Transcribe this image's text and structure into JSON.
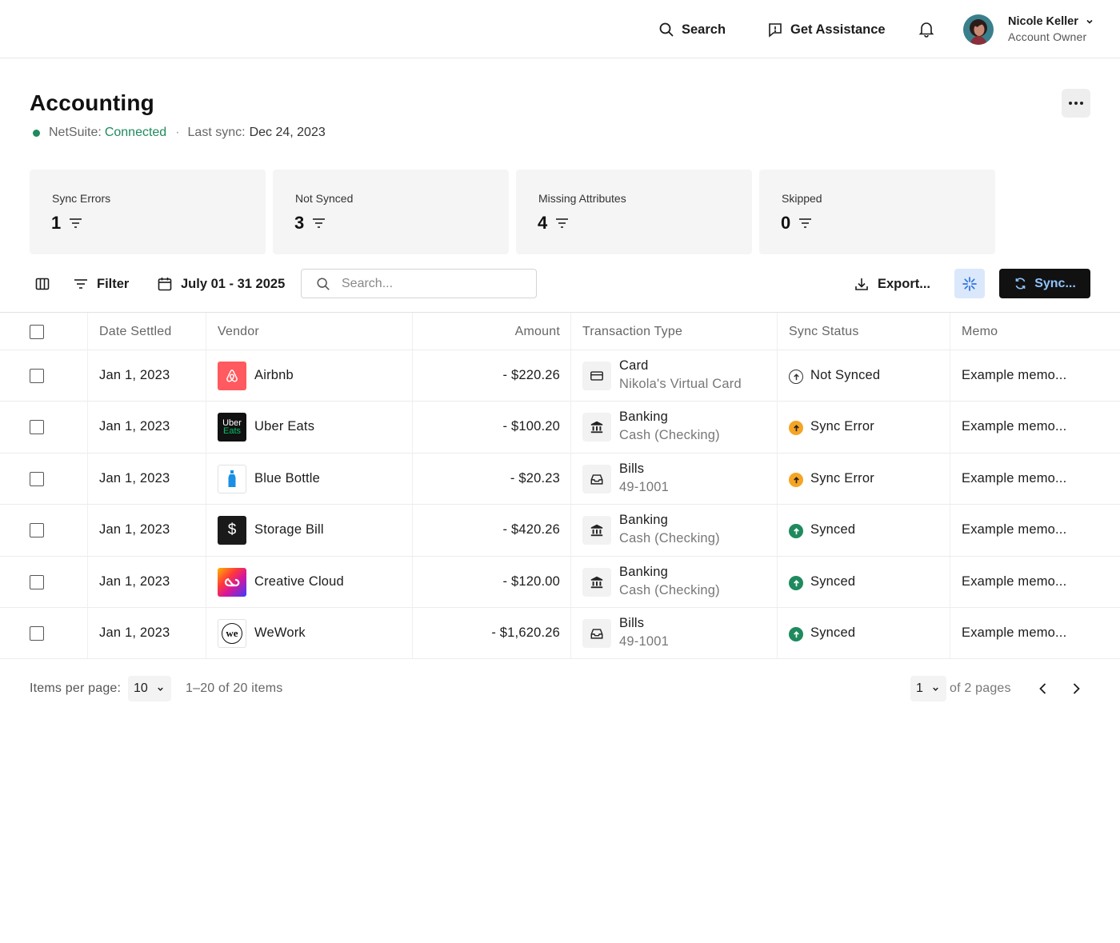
{
  "topbar": {
    "search_label": "Search",
    "assist_label": "Get Assistance",
    "user": {
      "name": "Nicole Keller",
      "role": "Account Owner"
    }
  },
  "header": {
    "title": "Accounting",
    "integration_name": "NetSuite:",
    "integration_status": "Connected",
    "last_sync_label": "Last sync:",
    "last_sync_date": "Dec 24, 2023"
  },
  "stats": [
    {
      "label": "Sync Errors",
      "value": "1"
    },
    {
      "label": "Not Synced",
      "value": "3"
    },
    {
      "label": "Missing Attributes",
      "value": "4"
    },
    {
      "label": "Skipped",
      "value": "0"
    }
  ],
  "toolbar": {
    "filter_label": "Filter",
    "date_range": "July 01 - 31 2025",
    "search_placeholder": "Search...",
    "export_label": "Export...",
    "sync_label": "Sync..."
  },
  "table": {
    "columns": [
      "Date Settled",
      "Vendor",
      "Amount",
      "Transaction Type",
      "Sync Status",
      "Memo"
    ],
    "rows": [
      {
        "date": "Jan 1, 2023",
        "vendor": "Airbnb",
        "logo": "airbnb-logo",
        "amount": "- $220.26",
        "type": "Card",
        "type_sub": "Nikola's Virtual Card",
        "type_icon": "card-icon",
        "status": "Not Synced",
        "status_icon": "not-synced-icon",
        "memo": "Example memo..."
      },
      {
        "date": "Jan 1, 2023",
        "vendor": "Uber Eats",
        "logo": "uber-eats-logo",
        "amount": "- $100.20",
        "type": "Banking",
        "type_sub": "Cash (Checking)",
        "type_icon": "bank-icon",
        "status": "Sync Error",
        "status_icon": "sync-error-icon",
        "memo": "Example memo..."
      },
      {
        "date": "Jan 1, 2023",
        "vendor": "Blue Bottle",
        "logo": "blue-bottle-logo",
        "amount": "- $20.23",
        "type": "Bills",
        "type_sub": "49-1001",
        "type_icon": "inbox-icon",
        "status": "Sync Error",
        "status_icon": "sync-error-icon",
        "memo": "Example memo..."
      },
      {
        "date": "Jan 1, 2023",
        "vendor": "Storage Bill",
        "logo": "dollar-logo",
        "amount": "- $420.26",
        "type": "Banking",
        "type_sub": "Cash (Checking)",
        "type_icon": "bank-icon",
        "status": "Synced",
        "status_icon": "synced-icon",
        "memo": "Example memo..."
      },
      {
        "date": "Jan 1, 2023",
        "vendor": "Creative Cloud",
        "logo": "creative-cloud-logo",
        "amount": "- $120.00",
        "type": "Banking",
        "type_sub": "Cash (Checking)",
        "type_icon": "bank-icon",
        "status": "Synced",
        "status_icon": "synced-icon",
        "memo": "Example memo..."
      },
      {
        "date": "Jan 1, 2023",
        "vendor": "WeWork",
        "logo": "wework-logo",
        "amount": "- $1,620.26",
        "type": "Bills",
        "type_sub": "49-1001",
        "type_icon": "inbox-icon",
        "status": "Synced",
        "status_icon": "synced-icon",
        "memo": "Example memo..."
      }
    ]
  },
  "pagination": {
    "per_page_label": "Items per page:",
    "per_page_value": "10",
    "range_text": "1–20 of 20 items",
    "page_value": "1",
    "of_pages": "of 2 pages"
  },
  "logos": {
    "uber_line1": "Uber",
    "uber_line2": "Eats",
    "dollar": "$",
    "wework": "we"
  },
  "colors": {
    "connected": "#1f8a5e",
    "sync_error": "#f5a524",
    "synced": "#1f8a5e",
    "sync_button_text": "#8fc3ff",
    "airbnb": "#ff5a5f"
  }
}
